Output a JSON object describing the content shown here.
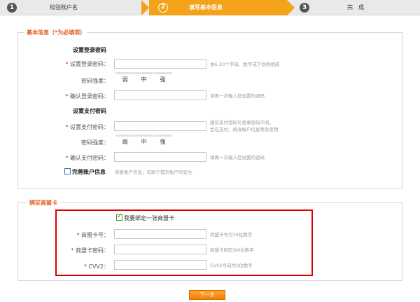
{
  "steps": [
    {
      "num": "1",
      "label": "校验账户名"
    },
    {
      "num": "2",
      "label": "填写基本信息"
    },
    {
      "num": "3",
      "label": "完　成"
    }
  ],
  "basic_info": {
    "legend": "基本信息（*为必填项）",
    "login_section_title": "设置登录密码",
    "login_password_label": "设置登录密码：",
    "login_password_hint": "由6-20个字母、数字或下划线组成",
    "strength_label": "密码强度：",
    "strength_levels": [
      "弱",
      "中",
      "强"
    ],
    "confirm_login_label": "确认登录密码：",
    "confirm_login_hint": "请再一次输入您设置的密码",
    "pay_section_title": "设置支付密码",
    "pay_password_label": "设置支付密码：",
    "pay_password_hint_1": "建议支付密码与登录密码不同，",
    "pay_password_hint_2": "会在支付、修改账户信息等处使用",
    "confirm_pay_label": "确认支付密码：",
    "confirm_pay_hint": "请再一次输入您设置的密码",
    "complete_label": "完善账户信息",
    "complete_hint": "完善账户信息，有助于提升账户的安全",
    "complete_checked": false
  },
  "bind_card": {
    "legend": "绑定商盟卡",
    "bind_checkbox_label": "我要绑定一张商盟卡",
    "bind_checked": true,
    "card_no_label": "商盟卡号：",
    "card_no_hint": "商盟卡号为19位数字",
    "card_pwd_label": "商盟卡密码：",
    "card_pwd_hint": "商盟卡密码为6位数字",
    "cvv2_label": "CVV2：",
    "cvv2_hint": "CVV2号码为3位数字"
  },
  "required_mark": "*",
  "next_button": "下一步",
  "colors": {
    "accent": "#f4a21a",
    "legend": "#e05a1a",
    "highlight": "#d80000"
  }
}
